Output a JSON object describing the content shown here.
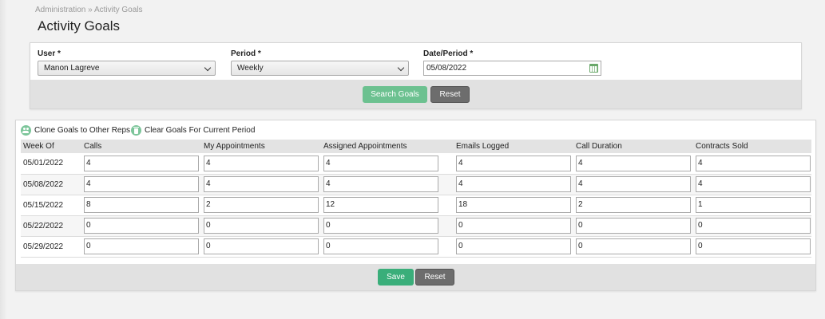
{
  "breadcrumb": {
    "parent": "Administration",
    "separator": "»",
    "current": "Activity Goals"
  },
  "page_title": "Activity Goals",
  "filters": {
    "user_label": "User *",
    "user_value": "Manon Lagreve",
    "period_label": "Period *",
    "period_value": "Weekly",
    "date_label": "Date/Period *",
    "date_value": "05/08/2022",
    "search_label": "Search Goals",
    "reset_label": "Reset"
  },
  "actions": {
    "clone_label": "Clone Goals to Other Reps",
    "clear_label": "Clear Goals For Current Period"
  },
  "table": {
    "headers": [
      "Week Of",
      "Calls",
      "My Appointments",
      "Assigned Appointments",
      "Emails Logged",
      "Call Duration",
      "Contracts Sold"
    ],
    "rows": [
      {
        "week": "05/01/2022",
        "values": [
          "4",
          "4",
          "4",
          "4",
          "4",
          "4"
        ]
      },
      {
        "week": "05/08/2022",
        "values": [
          "4",
          "4",
          "4",
          "4",
          "4",
          "4"
        ]
      },
      {
        "week": "05/15/2022",
        "values": [
          "8",
          "2",
          "12",
          "18",
          "2",
          "1"
        ]
      },
      {
        "week": "05/22/2022",
        "values": [
          "0",
          "0",
          "0",
          "0",
          "0",
          "0"
        ]
      },
      {
        "week": "05/29/2022",
        "values": [
          "0",
          "0",
          "0",
          "0",
          "0",
          "0"
        ]
      }
    ]
  },
  "footer": {
    "save_label": "Save",
    "reset_label": "Reset"
  },
  "colors": {
    "accent": "#3aae7a",
    "accent_light": "#6cc190",
    "button_gray": "#6d6d6d"
  }
}
